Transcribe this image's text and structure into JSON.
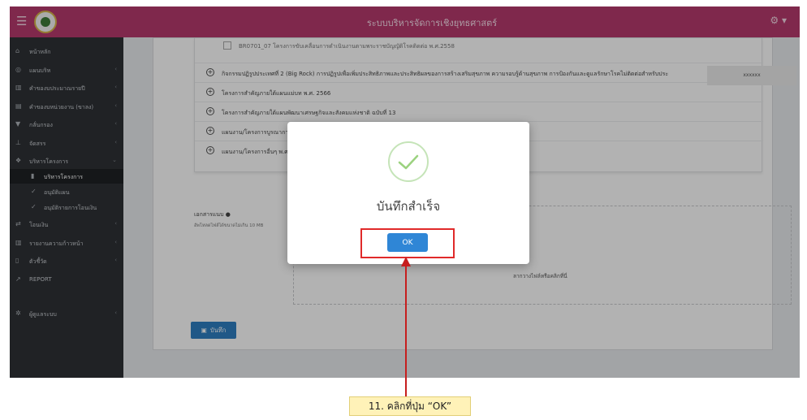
{
  "topbar": {
    "menu_icon": "☰",
    "title": "ระบบบริหารจัดการเชิงยุทธศาสตร์",
    "user_icon": "⚙ ▾"
  },
  "sidebar": {
    "items": [
      {
        "icon": "⌂",
        "label": "หน้าหลัก",
        "chevron": ""
      },
      {
        "icon": "◎",
        "label": "แผนบริห",
        "chevron": "‹"
      },
      {
        "icon": "▥",
        "label": "คำของบประมาณรายปี",
        "chevron": "‹"
      },
      {
        "icon": "▤",
        "label": "คำของบหน่วยงาน (ขาลง)",
        "chevron": "‹"
      },
      {
        "icon": "▼",
        "label": "กลั่นกรอง",
        "chevron": "‹"
      },
      {
        "icon": "⊥",
        "label": "จัดสรร",
        "chevron": "‹"
      },
      {
        "icon": "❖",
        "label": "บริหารโครงการ",
        "chevron": "⌄"
      },
      {
        "icon": "▮",
        "label": "บริหารโครงการ",
        "chevron": ""
      },
      {
        "icon": "✓",
        "label": "อนุมัติแผน",
        "chevron": ""
      },
      {
        "icon": "✓",
        "label": "อนุมัติรายการโอนเงิน",
        "chevron": ""
      },
      {
        "icon": "⇄",
        "label": "โอนเงิน",
        "chevron": "‹"
      },
      {
        "icon": "▥",
        "label": "รายงานความก้าวหน้า",
        "chevron": "‹"
      },
      {
        "icon": "▯",
        "label": "ตัวชี้วัด",
        "chevron": "‹"
      },
      {
        "icon": "↗",
        "label": "REPORT",
        "chevron": ""
      },
      {
        "icon": "✲",
        "label": "ผู้ดูแลระบบ",
        "chevron": "‹"
      }
    ]
  },
  "list": {
    "first_row": "BR0701_07 โครงการขับเคลื่อนการดำเนินงานตามพระราชบัญญัติโรคติดต่อ พ.ศ.2558",
    "rows": [
      "กิจกรรมปฏิรูปประเทศที่ 2 (Big Rock) การปฏิรูปเพื่อเพิ่มประสิทธิภาพและประสิทธิผลของการสร้างเสริมสุขภาพ ความรอบรู้ด้านสุขภาพ การป้องกันและดูแลรักษาโรคไม่ติดต่อสำหรับประ",
      "โครงการสำคัญภายใต้แผนแม่บท พ.ศ. 2566",
      "โครงการสำคัญภายใต้แผนพัฒนาเศรษฐกิจและสังคมแห่งชาติ ฉบับที่ 13",
      "แผนงาน/โครงการบูรณาการปีงบ",
      "แผนงาน/โครงการอื่นๆ พ.ศ. 256"
    ]
  },
  "redacted_text": "xxxxxx",
  "documents": {
    "label": "เอกสารแนบ",
    "info_icon": "●",
    "hint": "อัพโหลดไฟล์ได้ขนาดไม่เกิน 10 MB",
    "drop_text": "ลากวางไฟล์หรือคลิกที่นี่"
  },
  "save_button": {
    "icon": "▣",
    "label": "บันทึก"
  },
  "modal": {
    "title": "บันทึกสำเร็จ",
    "ok_label": "OK"
  },
  "annotation": {
    "callout": "11. คลิกที่ปุ่ม “OK”"
  }
}
